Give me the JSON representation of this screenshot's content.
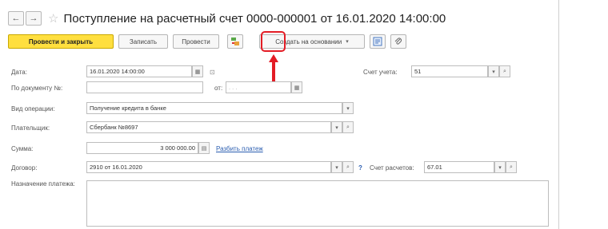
{
  "window": {
    "title": "Поступление на расчетный счет 0000-000001 от 16.01.2020 14:00:00"
  },
  "nav": {
    "back": "←",
    "forward": "→",
    "favorite": "☆"
  },
  "toolbar": {
    "post_close": "Провести и закрыть",
    "save": "Записать",
    "post": "Провести",
    "create_based_on": "Создать на основании",
    "dropdown_glyph": "▾"
  },
  "form": {
    "date_label": "Дата:",
    "date_value": "16.01.2020 14:00:00",
    "account_label": "Счет учета:",
    "account_value": "51",
    "doc_number_label": "По документу №:",
    "doc_number_value": "",
    "from_label": "от:",
    "from_placeholder": ". . .",
    "operation_label": "Вид операции:",
    "operation_value": "Получение кредита в банке",
    "payer_label": "Плательщик:",
    "payer_value": "Сбербанк №8697",
    "amount_label": "Сумма:",
    "amount_value": "3 000 000.00",
    "split_payment_link": "Разбить платеж",
    "contract_label": "Договор:",
    "contract_value": "2910 от 16.01.2020",
    "help_mark": "?",
    "settlement_account_label": "Счет расчетов:",
    "settlement_account_value": "67.01",
    "purpose_label": "Назначение платежа:",
    "purpose_value": ""
  },
  "colors": {
    "primary_button": "#ffdf3f",
    "highlight": "#e31c25",
    "link": "#2a5db0"
  }
}
